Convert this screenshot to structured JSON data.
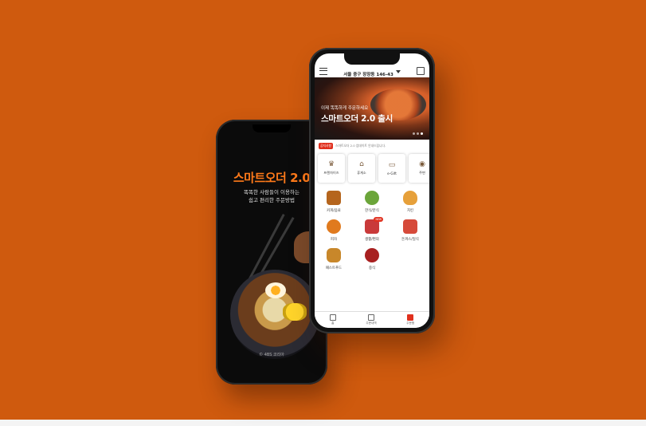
{
  "splash": {
    "title": "스마트오더 2.0",
    "subtitle_line1": "똑똑한 사람들이 이용하는",
    "subtitle_line2": "쉽고 편리한 주문방법",
    "footer": "© 4BS 코리아"
  },
  "app": {
    "address": "서울 중구 장장동 146-43",
    "banner": {
      "subtitle": "이제 똑똑하게 주문하세요",
      "title": "스마트오더 2.0 출시"
    },
    "notice": {
      "badge": "공지사항",
      "text": "스마트오더 2.0 업데이트 안내드립니다."
    },
    "quick_menu": [
      {
        "label": "프랜차이즈",
        "icon": "crown-icon"
      },
      {
        "label": "휴게소",
        "icon": "house-icon"
      },
      {
        "label": "e-Gift",
        "icon": "gift-card-icon"
      },
      {
        "label": "주변",
        "icon": "location-icon"
      }
    ],
    "categories": [
      {
        "label": "커피/음료",
        "icon": "coffee-icon",
        "color": "#b5651d"
      },
      {
        "label": "한식/분식",
        "icon": "bibimbap-icon",
        "color": "#6ba53a"
      },
      {
        "label": "치킨",
        "icon": "chicken-icon",
        "color": "#e6a03a"
      },
      {
        "label": "피자",
        "icon": "pizza-icon",
        "color": "#e07a1e"
      },
      {
        "label": "생활/편의",
        "icon": "store-icon",
        "color": "#c93a3a",
        "badge": "NEW"
      },
      {
        "label": "돈까스/일식",
        "icon": "sushi-icon",
        "color": "#d64a3a"
      },
      {
        "label": "패스트푸드",
        "icon": "burger-icon",
        "color": "#c8872a"
      },
      {
        "label": "중식",
        "icon": "noodle-bowl-icon",
        "color": "#a82020"
      }
    ],
    "tabs": [
      {
        "label": "홈",
        "icon": "home-icon"
      },
      {
        "label": "주문내역",
        "icon": "receipt-icon"
      },
      {
        "label": "주문함",
        "icon": "cart-icon"
      }
    ]
  }
}
